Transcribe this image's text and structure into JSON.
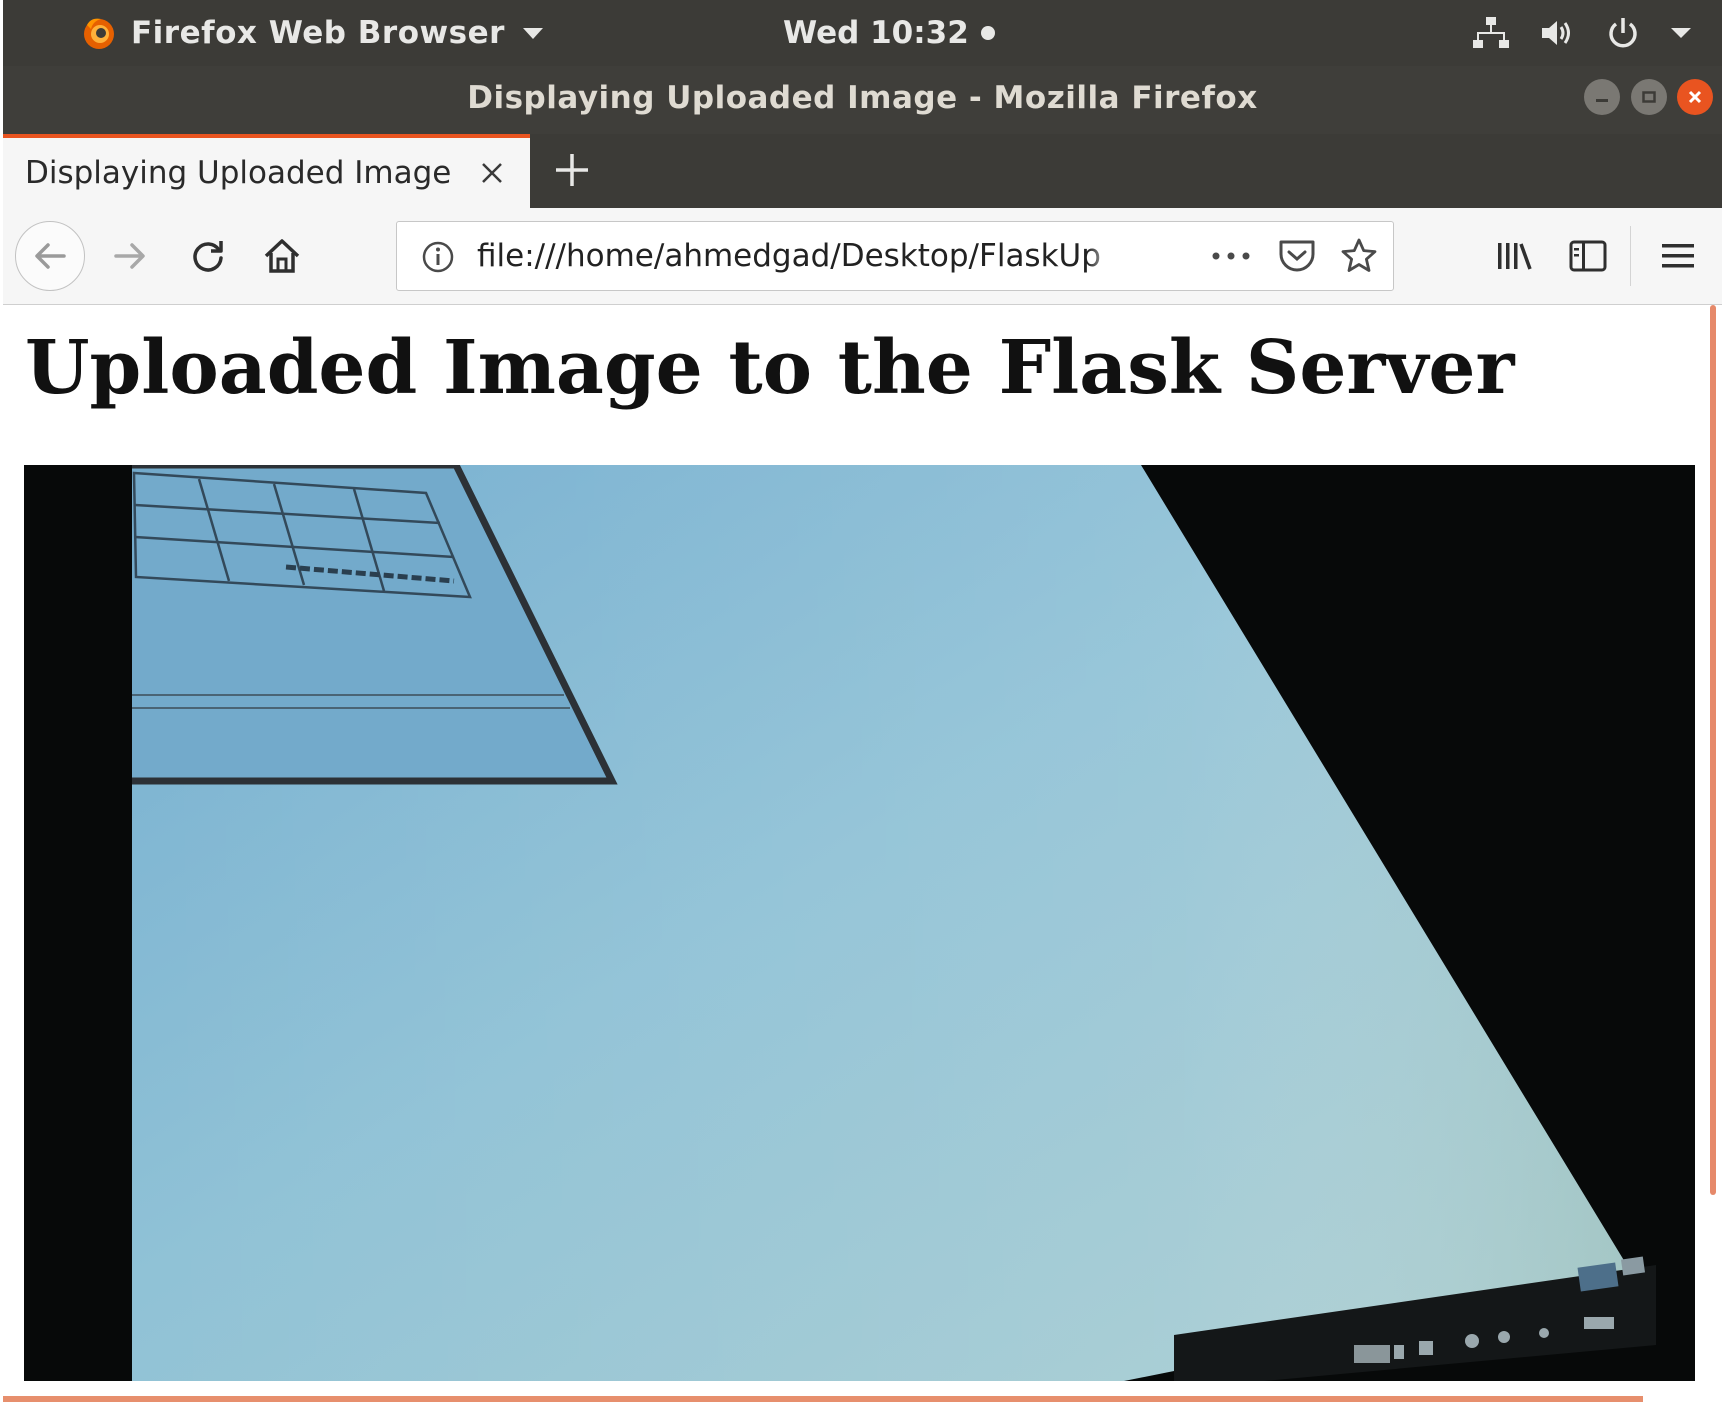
{
  "top_bar": {
    "app_menu_label": "Firefox Web Browser",
    "clock": "Wed 10:32",
    "tray_icons": [
      "network-icon",
      "volume-icon",
      "power-icon",
      "system-menu-chevron-icon"
    ]
  },
  "window": {
    "title": "Displaying Uploaded Image - Mozilla Firefox",
    "controls": [
      "minimize",
      "maximize",
      "close"
    ]
  },
  "tabs": [
    {
      "title": "Displaying Uploaded Image",
      "active": true
    }
  ],
  "toolbar": {
    "url": "file:///home/ahmedgad/Desktop/FlaskUp",
    "page_actions_label": "•••"
  },
  "page": {
    "heading": "Uploaded Image to the Flask Server"
  },
  "colors": {
    "ubuntu_orange": "#e95420",
    "topbar_bg": "#3c3b37",
    "toolbar_bg": "#f6f6f6",
    "scrollbar": "#e6896a"
  }
}
